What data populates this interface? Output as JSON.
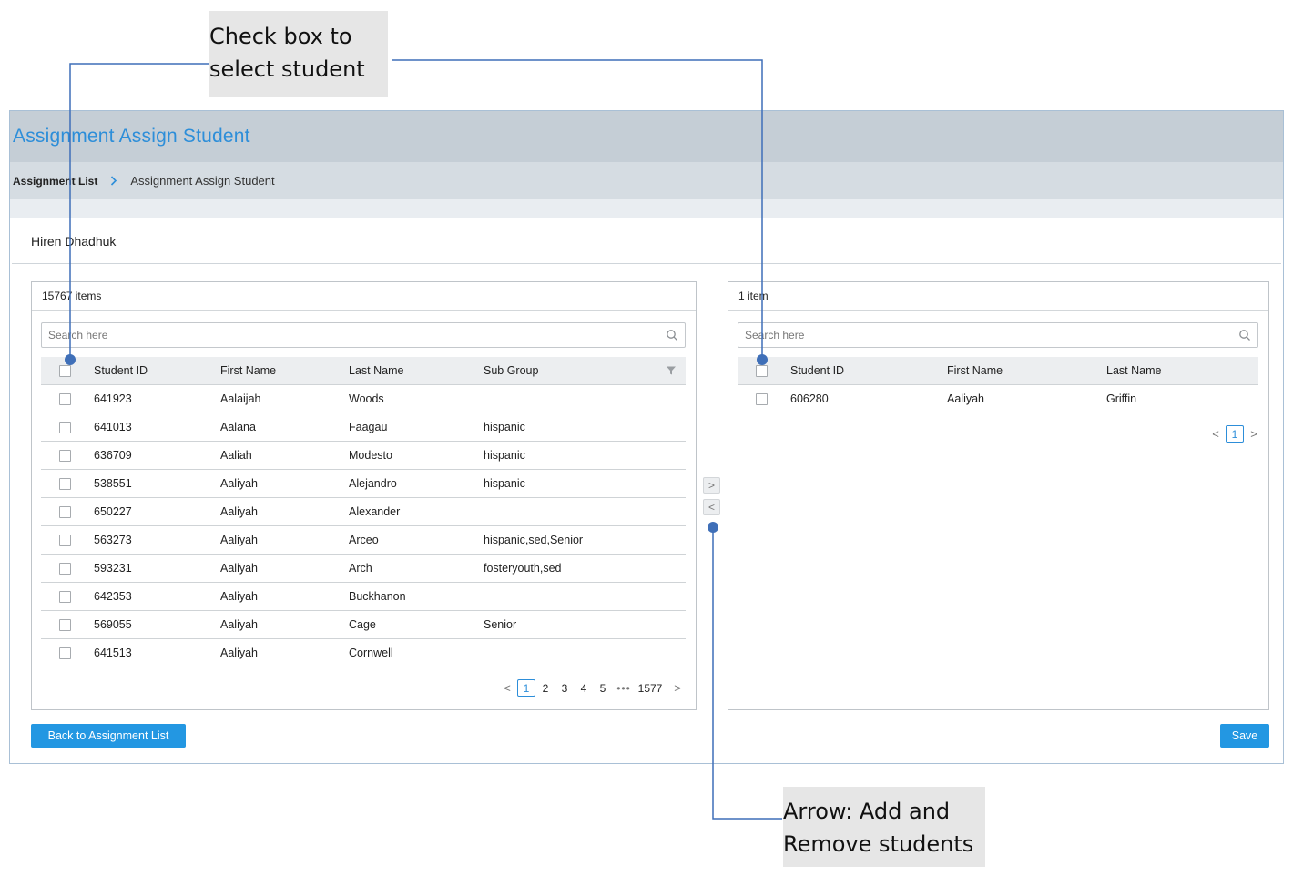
{
  "callouts": {
    "checkbox": [
      "Check box to",
      "select student"
    ],
    "arrow": [
      "Arrow: Add and",
      "Remove students"
    ]
  },
  "app": {
    "title": "Assignment Assign Student",
    "breadcrumb": {
      "link": "Assignment List",
      "separator": ">",
      "current": "Assignment Assign Student"
    },
    "user_name": "Hiren Dhadhuk"
  },
  "source_panel": {
    "count_label": "15767 items",
    "search_placeholder": "Search here",
    "columns": [
      "Student ID",
      "First Name",
      "Last Name",
      "Sub Group"
    ],
    "rows": [
      [
        "641923",
        "Aalaijah",
        "Woods",
        ""
      ],
      [
        "641013",
        "Aalana",
        "Faagau",
        "hispanic"
      ],
      [
        "636709",
        "Aaliah",
        "Modesto",
        "hispanic"
      ],
      [
        "538551",
        "Aaliyah",
        "Alejandro",
        "hispanic"
      ],
      [
        "650227",
        "Aaliyah",
        "Alexander",
        ""
      ],
      [
        "563273",
        "Aaliyah",
        "Arceo",
        "hispanic,sed,Senior"
      ],
      [
        "593231",
        "Aaliyah",
        "Arch",
        "fosteryouth,sed"
      ],
      [
        "642353",
        "Aaliyah",
        "Buckhanon",
        ""
      ],
      [
        "569055",
        "Aaliyah",
        "Cage",
        "Senior"
      ],
      [
        "641513",
        "Aaliyah",
        "Cornwell",
        ""
      ]
    ],
    "pagination": {
      "prev": "<",
      "pages": [
        "1",
        "2",
        "3",
        "4",
        "5"
      ],
      "active": "1",
      "ellipsis": "•••",
      "last": "1577",
      "next": ">"
    }
  },
  "target_panel": {
    "count_label": "1 item",
    "search_placeholder": "Search here",
    "columns": [
      "Student ID",
      "First Name",
      "Last Name"
    ],
    "rows": [
      [
        "606280",
        "Aaliyah",
        "Griffin"
      ]
    ],
    "pagination": {
      "prev": "<",
      "pages": [
        "1"
      ],
      "active": "1",
      "next": ">"
    }
  },
  "transfer": {
    "add": ">",
    "remove": "<"
  },
  "buttons": {
    "back": "Back to Assignment List",
    "save": "Save"
  },
  "colors": {
    "accent": "#2397e2",
    "title": "#2d8ed9",
    "connector": "#3f6fb8",
    "callout_bg": "#e6e6e6"
  },
  "icons": {
    "search": "search-icon",
    "filter": "filter-icon",
    "breadcrumb_chevron": "chevron-right-icon"
  }
}
